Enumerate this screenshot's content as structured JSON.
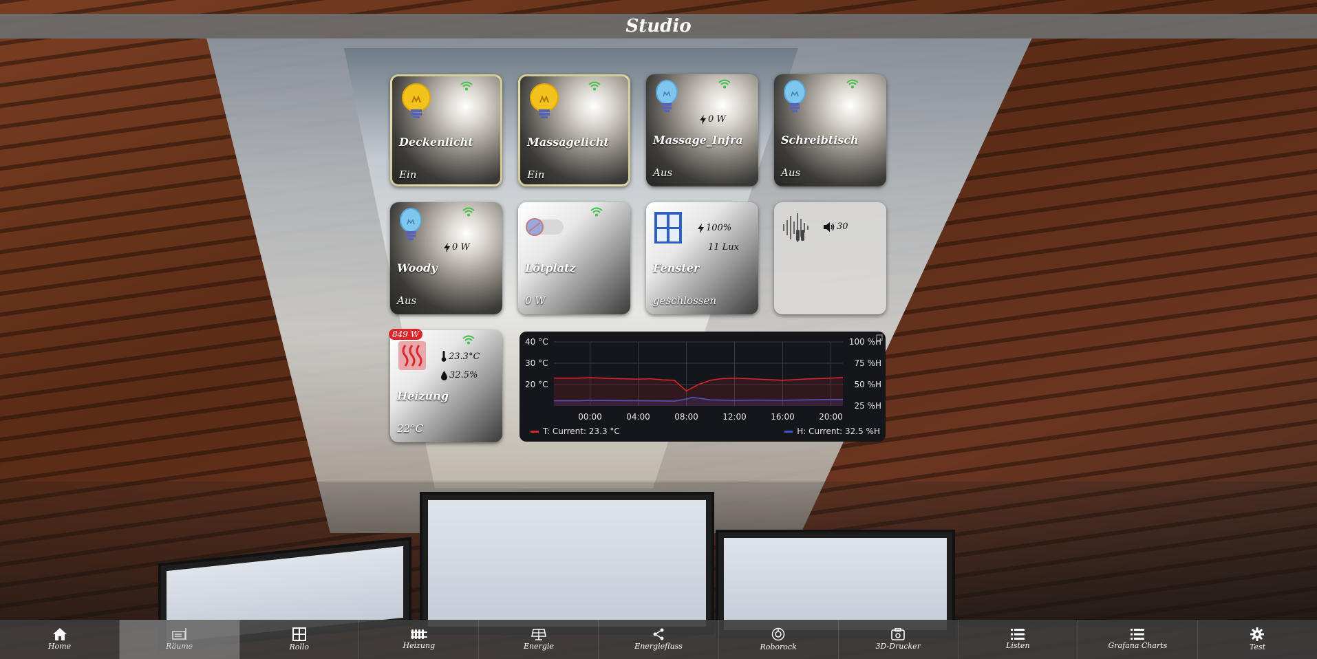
{
  "header": {
    "title": "Studio"
  },
  "tiles": [
    {
      "name": "Deckenlicht",
      "state": "Ein"
    },
    {
      "name": "Massagelicht",
      "state": "Ein"
    },
    {
      "name": "Massage_Infra",
      "state": "Aus",
      "power": "0 W"
    },
    {
      "name": "Schreibtisch",
      "state": "Aus"
    },
    {
      "name": "Woody",
      "state": "Aus",
      "power": "0 W"
    },
    {
      "name": "Lötplatz",
      "state": "0 W"
    },
    {
      "name": "Fenster",
      "state": "geschlossen",
      "power": "100%",
      "lux": "11 Lux"
    },
    {
      "volume": "30"
    },
    {
      "name": "Heizung",
      "state": "22°C",
      "badge": "849 W",
      "temperature": "23.3°C",
      "humidity": "32.5%"
    }
  ],
  "chart_data": {
    "type": "line",
    "x_ticks": [
      "00:00",
      "04:00",
      "08:00",
      "12:00",
      "16:00",
      "20:00"
    ],
    "y_left_ticks": [
      "40 °C",
      "30 °C",
      "20 °C"
    ],
    "y_right_ticks": [
      "100 %H",
      "75 %H",
      "50 %H",
      "25 %H"
    ],
    "series": [
      {
        "name": "T",
        "legend": "T:  Current: 23.3 °C",
        "color": "#d9262a",
        "x_hours": [
          -3,
          -1,
          0,
          2,
          4,
          5,
          6,
          7,
          7.6,
          8,
          9,
          10,
          11,
          12,
          14,
          16,
          18,
          20,
          21
        ],
        "values": [
          23.0,
          23.0,
          23.2,
          22.8,
          22.5,
          22.7,
          22.2,
          22.0,
          19.0,
          17.0,
          20.0,
          22.0,
          22.8,
          23.0,
          22.5,
          22.0,
          22.6,
          23.0,
          23.3
        ]
      },
      {
        "name": "H",
        "legend": "H:  Current: 32.5 %H",
        "color": "#3a5bd0",
        "x_hours": [
          -3,
          -1,
          0,
          2,
          4,
          6,
          7,
          8,
          8.5,
          9,
          10,
          12,
          14,
          16,
          18,
          20,
          21
        ],
        "values": [
          31.0,
          31.0,
          31.5,
          31.2,
          31.0,
          30.8,
          30.5,
          33.0,
          35.0,
          34.0,
          32.0,
          31.5,
          31.8,
          31.5,
          32.0,
          32.5,
          32.5
        ]
      }
    ]
  },
  "nav": [
    {
      "label": "Home",
      "icon": "home-icon"
    },
    {
      "label": "Räume",
      "icon": "rooms-icon"
    },
    {
      "label": "Rollo",
      "icon": "window-icon"
    },
    {
      "label": "Heizung",
      "icon": "radiator-icon"
    },
    {
      "label": "Energie",
      "icon": "solar-panel-icon"
    },
    {
      "label": "Energiefluss",
      "icon": "share-icon"
    },
    {
      "label": "Roborock",
      "icon": "robot-vacuum-icon"
    },
    {
      "label": "3D-Drucker",
      "icon": "printer-icon"
    },
    {
      "label": "Listen",
      "icon": "list-icon"
    },
    {
      "label": "Grafana Charts",
      "icon": "list-icon"
    },
    {
      "label": "Test",
      "icon": "gear-icon"
    }
  ],
  "colors": {
    "wifi": "#3fbf4a",
    "bulb_on": "#f2c21d",
    "bulb_off": "#7fc6ef",
    "badge": "#d9262a",
    "temp_line": "#d9262a",
    "hum_line": "#3a5bd0"
  }
}
